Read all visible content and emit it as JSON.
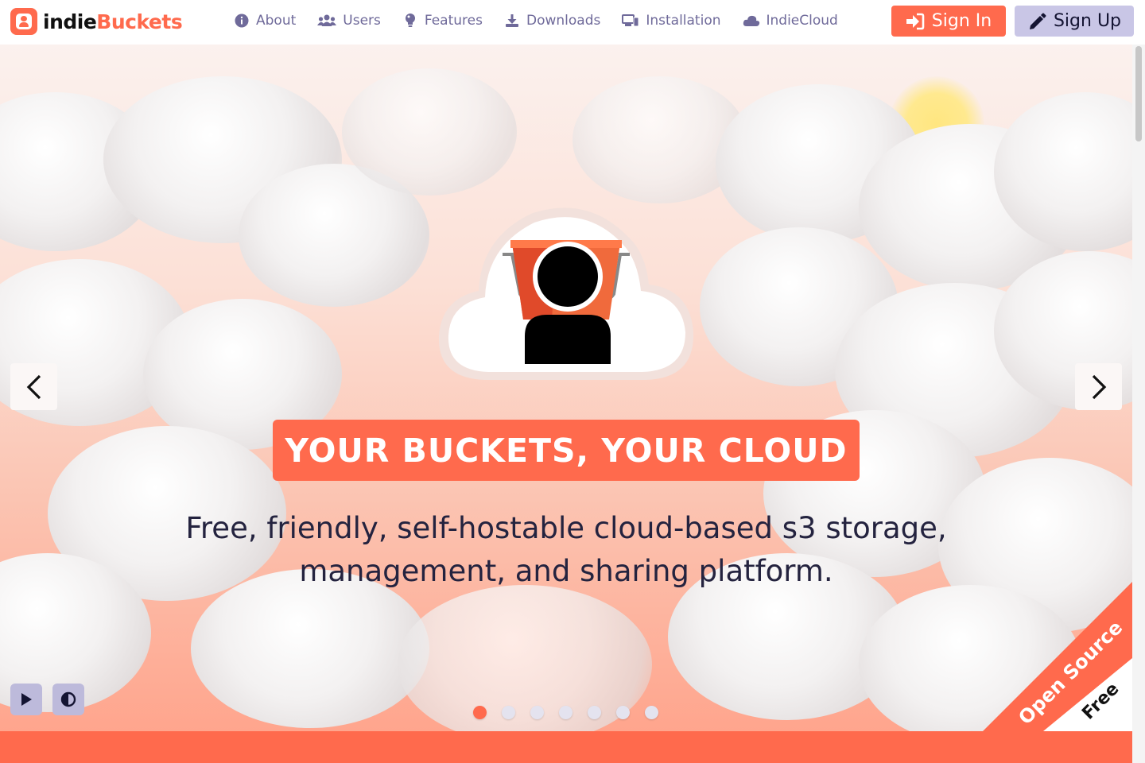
{
  "brand": {
    "name_part1": "indie",
    "name_part2": "Buckets"
  },
  "nav": {
    "items": [
      {
        "label": "About",
        "icon": "info-icon"
      },
      {
        "label": "Users",
        "icon": "users-icon"
      },
      {
        "label": "Features",
        "icon": "lightbulb-icon"
      },
      {
        "label": "Downloads",
        "icon": "download-icon"
      },
      {
        "label": "Installation",
        "icon": "devices-icon"
      },
      {
        "label": "IndieCloud",
        "icon": "cloud-icon"
      }
    ],
    "signin_label": "Sign In",
    "signup_label": "Sign Up"
  },
  "hero": {
    "headline": "YOUR BUCKETS, YOUR CLOUD",
    "subline_line1": "Free, friendly, self-hostable cloud-based s3 storage,",
    "subline_line2": "management, and sharing platform.",
    "slide_count": 7,
    "active_slide": 1
  },
  "ribbon": {
    "top_text": "Open Source",
    "bottom_text": "Free"
  },
  "colors": {
    "accent": "#ff6a4d",
    "nav_text": "#6f6a9a",
    "secondary_button": "#c9c6e6",
    "text_dark": "#24233f"
  }
}
